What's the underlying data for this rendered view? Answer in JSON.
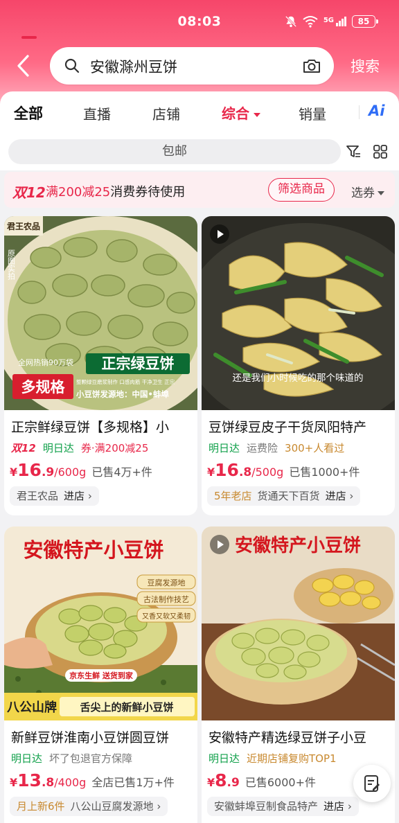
{
  "status_bar": {
    "time": "08:03",
    "signal_labels": "5G",
    "battery": "85"
  },
  "search": {
    "query": "安徽滁州豆饼",
    "button": "搜索"
  },
  "tabs": [
    {
      "label": "全部"
    },
    {
      "label": "直播"
    },
    {
      "label": "店铺"
    },
    {
      "label": "综合"
    },
    {
      "label": "销量"
    }
  ],
  "ai_label": "Ai",
  "filter_pill": "包邮",
  "coupon": {
    "event": "双12",
    "highlight": "满200减25",
    "text": "消费券待使用",
    "filter_button": "筛选商品",
    "select_label": "选券"
  },
  "products": [
    {
      "title": "正宗鲜绿豆饼【多规格】小",
      "tags": {
        "event": "双12",
        "delivery": "明日达",
        "promo": "券·满200减25"
      },
      "price": {
        "symbol": "¥",
        "int": "16",
        "dec": ".9",
        "unit": "/600g"
      },
      "sold": "已售4万+件",
      "shop": {
        "prefix": "",
        "name": "君王农品",
        "link": "进店"
      },
      "image": {
        "brand": "君王农品",
        "side_text": "原图实拍",
        "banner_top": "全网热销90万袋",
        "headline": "正宗绿豆饼",
        "spec": "多规格",
        "features": "整颗绿豆磨浆制作 口感肉筋 干净卫生 正宗",
        "origin": "小豆饼发源地：中国•蚌埠"
      }
    },
    {
      "title": "豆饼绿豆皮子干货凤阳特产",
      "tags": {
        "delivery": "明日达",
        "insurance": "运费险",
        "views": "300+人看过"
      },
      "price": {
        "symbol": "¥",
        "int": "16",
        "dec": ".8",
        "unit": "/500g"
      },
      "sold": "已售1000+件",
      "shop": {
        "prefix": "5年老店",
        "name": "货通天下百货",
        "link": "进店"
      },
      "image": {
        "subtitle": "还是我们小时候吃的那个味道的"
      }
    },
    {
      "title": "新鲜豆饼淮南小豆饼圆豆饼",
      "tags": {
        "delivery": "明日达",
        "guarantee": "坏了包退官方保障"
      },
      "price": {
        "symbol": "¥",
        "int": "13",
        "dec": ".8",
        "unit": "/400g"
      },
      "sold": "全店已售1万+件",
      "shop": {
        "prefix": "月上新6件",
        "name": "八公山豆腐发源地",
        "link": ""
      },
      "image": {
        "headline": "安徽特产小豆饼",
        "badges": [
          "豆腐发源地",
          "古法制作技艺",
          "又香又软又柔韧"
        ],
        "jd": "京东生鲜 送货到家",
        "brand": "八公山牌",
        "slogan": "舌尖上的新鲜小豆饼"
      }
    },
    {
      "title": "安徽特产精选绿豆饼子小豆",
      "tags": {
        "delivery": "明日达",
        "rank": "近期店铺复购TOP1"
      },
      "price": {
        "symbol": "¥",
        "int": "8",
        "dec": ".9",
        "unit": ""
      },
      "sold": "已售6000+件",
      "shop": {
        "prefix": "",
        "name": "安徽蚌埠豆制食品特产",
        "link": "进店"
      },
      "image": {
        "headline": "安徽特产小豆饼"
      }
    }
  ],
  "colors": {
    "accent": "#e8274a",
    "green": "#10a04a",
    "orange": "#c8892f"
  }
}
